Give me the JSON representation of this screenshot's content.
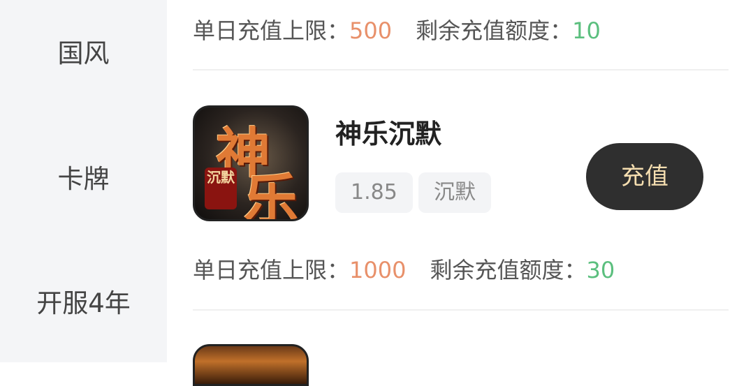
{
  "sidebar": {
    "items": [
      {
        "label": "国风"
      },
      {
        "label": "卡牌"
      },
      {
        "label": "开服4年"
      }
    ]
  },
  "rows": [
    {
      "limit_label": "单日充值上限：",
      "limit_value": "500",
      "remain_label": "剩余充值额度：",
      "remain_value": "10"
    },
    {
      "title": "神乐沉默",
      "icon_text_1": "神",
      "icon_text_2": "乐",
      "icon_seal": "沉默",
      "tags": [
        "1.85",
        "沉默"
      ],
      "button_label": "充值",
      "limit_label": "单日充值上限：",
      "limit_value": "1000",
      "remain_label": "剩余充值额度：",
      "remain_value": "30"
    }
  ],
  "colors": {
    "limit_value": "#e8906a",
    "remain_value": "#5bbf7e",
    "button_bg": "#2f2f2f",
    "button_text": "#f5deb0"
  }
}
